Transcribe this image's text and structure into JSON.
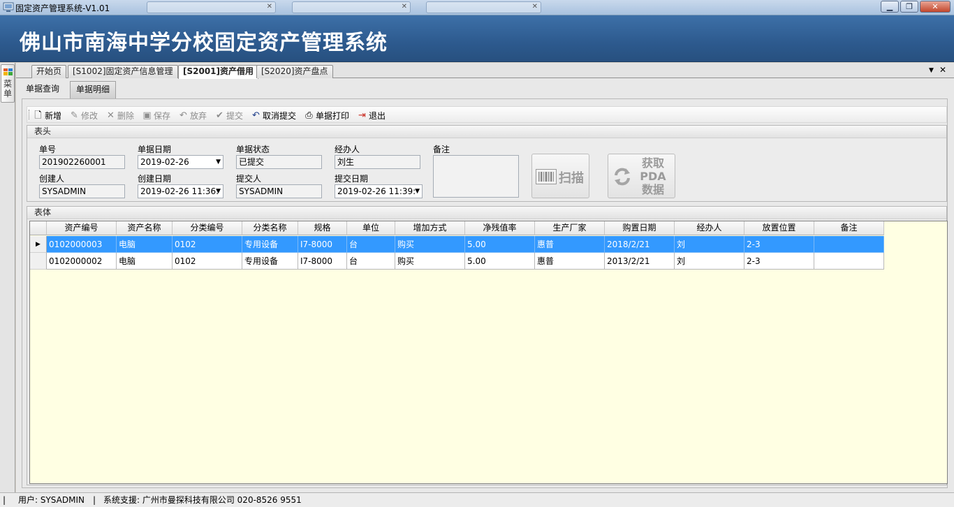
{
  "window": {
    "title": "固定资产管理系统-V1.01",
    "buttons": {
      "minimize": "▁",
      "maximize": "❐",
      "close": "✕"
    }
  },
  "banner": {
    "title": "佛山市南海中学分校固定资产管理系统"
  },
  "side_menu": {
    "label": "菜单",
    "icon": "menu-grid-icon"
  },
  "doc_tabs": [
    {
      "label": "开始页",
      "active": false
    },
    {
      "label": "[S1002]固定资产信息管理",
      "active": false
    },
    {
      "label": "[S2001]资产借用",
      "active": true
    },
    {
      "label": "[S2020]资产盘点",
      "active": false
    }
  ],
  "tab_controls": {
    "dropdown": "▼",
    "close": "✕"
  },
  "sub_tabs": [
    {
      "label": "单据查询",
      "active": false
    },
    {
      "label": "单据明细",
      "active": true
    }
  ],
  "toolbar": {
    "new": "新增",
    "edit": "修改",
    "delete": "删除",
    "save": "保存",
    "discard": "放弃",
    "submit": "提交",
    "cancel_submit": "取消提交",
    "print": "单据打印",
    "exit": "退出"
  },
  "header_section": {
    "title": "表头",
    "doc_no_label": "单号",
    "doc_no": "201902260001",
    "doc_date_label": "单据日期",
    "doc_date": "2019-02-26",
    "status_label": "单据状态",
    "status": "已提交",
    "handler_label": "经办人",
    "handler": "刘生",
    "remark_label": "备注",
    "remark": "",
    "creator_label": "创建人",
    "creator": "SYSADMIN",
    "create_date_label": "创建日期",
    "create_date": "2019-02-26 11:36:",
    "submitter_label": "提交人",
    "submitter": "SYSADMIN",
    "submit_date_label": "提交日期",
    "submit_date": "2019-02-26 11:39:",
    "scan_button": "扫描",
    "pda_button_lines": [
      "获取",
      "PDA",
      "数据"
    ]
  },
  "body_section": {
    "title": "表体",
    "columns": [
      "资产编号",
      "资产名称",
      "分类编号",
      "分类名称",
      "规格",
      "单位",
      "增加方式",
      "净残值率",
      "生产厂家",
      "购置日期",
      "经办人",
      "放置位置",
      "备注"
    ],
    "rows": [
      [
        "0102000003",
        "电脑",
        "0102",
        "专用设备",
        "I7-8000",
        "台",
        "购买",
        "5.00",
        "惠普",
        "2018/2/21",
        "刘",
        "2-3",
        ""
      ],
      [
        "0102000002",
        "电脑",
        "0102",
        "专用设备",
        "I7-8000",
        "台",
        "购买",
        "5.00",
        "惠普",
        "2013/2/21",
        "刘",
        "2-3",
        ""
      ]
    ],
    "selected_row": 0
  },
  "status_bar": {
    "user": "用户: SYSADMIN",
    "support": "系统支援: 广州市曼探科技有限公司 020-8526 9551"
  }
}
